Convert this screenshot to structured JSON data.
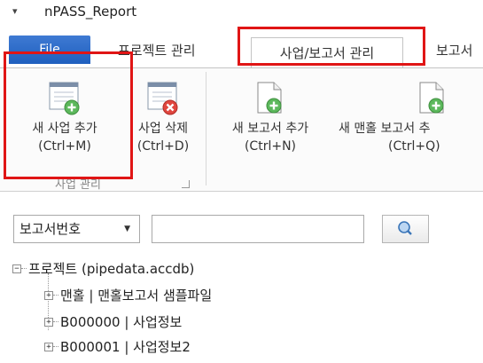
{
  "window": {
    "title": "nPASS_Report",
    "qat_glyph": "▾"
  },
  "ribbon_tabs": {
    "file": "File",
    "project": "프로젝트 관리",
    "business_report": "사업/보고서 관리",
    "report_partial": "보고서"
  },
  "ribbon": {
    "new_business": {
      "label": "새 사업 추가",
      "shortcut": "(Ctrl+M)"
    },
    "delete_business": {
      "label": "사업 삭제",
      "shortcut": "(Ctrl+D)"
    },
    "new_report": {
      "label": "새 보고서 추가",
      "shortcut": "(Ctrl+N)"
    },
    "new_cover_report": {
      "label": "새 맨홀 보고서 추",
      "shortcut": "(Ctrl+Q)"
    },
    "group_label": "사업 관리"
  },
  "search": {
    "field_selected": "보고서번호",
    "query": ""
  },
  "tree": {
    "root": "프로젝트 (pipedata.accdb)",
    "children": [
      "맨홀 | 맨홀보고서 샘플파일",
      "B000000 | 사업정보",
      "B000001 | 사업정보2"
    ]
  },
  "colors": {
    "file_tab": "#2a6ac9",
    "highlight": "#e01515",
    "icon_add": "#5cb85c",
    "icon_delete": "#e0463f"
  },
  "icons": {
    "doc_add": "document-plus-icon",
    "doc_delete": "document-x-icon",
    "search": "magnifier-icon"
  }
}
